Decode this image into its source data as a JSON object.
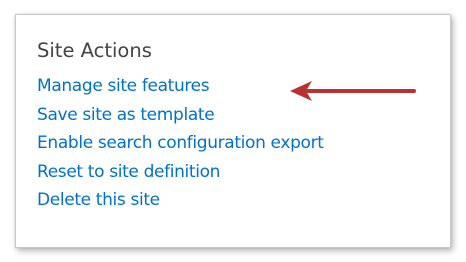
{
  "site_actions": {
    "heading": "Site Actions",
    "links": [
      {
        "label": "Manage site features"
      },
      {
        "label": "Save site as template"
      },
      {
        "label": "Enable search configuration export"
      },
      {
        "label": "Reset to site definition"
      },
      {
        "label": "Delete this site"
      }
    ]
  },
  "annotation": {
    "arrow_icon": "left-arrow-icon",
    "arrow_color": "#b83232"
  },
  "colors": {
    "link": "#0072c6",
    "heading": "#444444",
    "border": "#c9c9c9"
  }
}
